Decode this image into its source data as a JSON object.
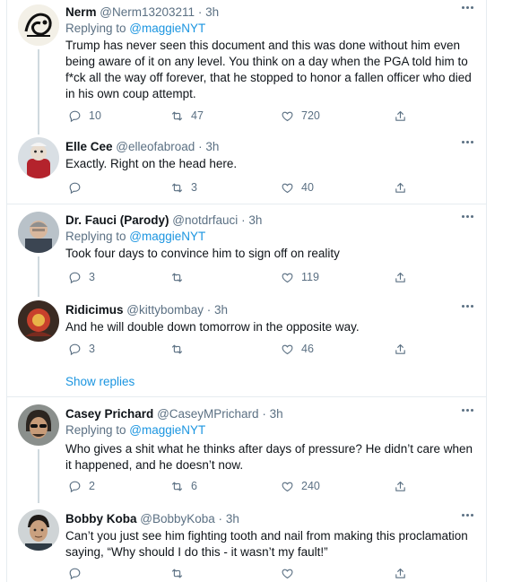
{
  "tweets": [
    {
      "name": "Nerm",
      "handle": "@Nerm13203211",
      "time": "3h",
      "replying_prefix": "Replying to ",
      "replying_to": "@maggieNYT",
      "text": "Trump has never seen this document and this was done without him even being aware of it on any level. You think on a day when the PGA told him to f*ck all the way off forever, that he stopped to honor a fallen officer who died in his own coup attempt.",
      "replies": "10",
      "retweets": "47",
      "likes": "720"
    },
    {
      "name": "Elle Cee",
      "handle": "@elleofabroad",
      "time": "3h",
      "text": "Exactly.  Right on the head here.",
      "replies": "",
      "retweets": "3",
      "likes": "40"
    },
    {
      "name": "Dr. Fauci (Parody)",
      "handle": "@notdrfauci",
      "time": "3h",
      "replying_prefix": "Replying to ",
      "replying_to": "@maggieNYT",
      "text": "Took four days to convince him to sign off on reality",
      "replies": "3",
      "retweets": "",
      "likes": "119"
    },
    {
      "name": "Ridicimus",
      "handle": "@kittybombay",
      "time": "3h",
      "text": "And he will double down tomorrow in the opposite way.",
      "replies": "3",
      "retweets": "",
      "likes": "46"
    },
    {
      "name": "Casey Prichard",
      "handle": "@CaseyMPrichard",
      "time": "3h",
      "replying_prefix": "Replying to ",
      "replying_to": "@maggieNYT",
      "text": "Who gives a shit what he thinks after days of pressure? He didn’t care when it happened, and he doesn’t now.",
      "replies": "2",
      "retweets": "6",
      "likes": "240"
    },
    {
      "name": "Bobby Koba",
      "handle": "@BobbyKoba",
      "time": "3h",
      "text": "Can’t you just see him fighting tooth and nail from making this proclamation saying, “Why should I do this - it wasn’t my fault!”",
      "replies": "",
      "retweets": "",
      "likes": ""
    }
  ],
  "show_replies": "Show replies",
  "separator": "·",
  "colors": {
    "accent": "#1b95e0",
    "muted": "#5b7083",
    "border": "#e6ecf0"
  }
}
